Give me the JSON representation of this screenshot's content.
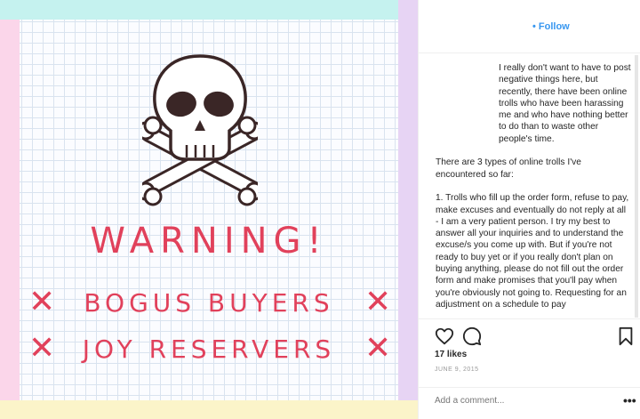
{
  "image": {
    "title": "WARNING!",
    "lines": [
      {
        "mark": "✕",
        "text": "BOGUS BUYERS"
      },
      {
        "mark": "✕",
        "text": "JOY RESERVERS"
      }
    ],
    "colors": {
      "accent": "#e1415b",
      "top_band": "#c5f2ef",
      "left_band": "#fbd6ea",
      "right_band": "#e7d4f4",
      "bottom_band": "#fbf4c9"
    }
  },
  "post": {
    "follow_label": "• Follow",
    "caption": {
      "p1": "I really don't want to have to post negative things here, but recently, there have been online trolls who have been harassing me and who have nothing better to do than to waste other people's time.",
      "p2": "There are 3 types of online trolls I've encountered so far:",
      "p3": "1. Trolls who fill up the order form, refuse to pay, make excuses and eventually do not reply at all - I am a very patient person. I try my best to answer all your inquiries and to understand the excuse/s you come up with. But if you're not ready to buy yet or if you really don't plan on buying anything, please do not fill out the order form and make promises that you'll pay when you're obviously not going to. Requesting for an adjustment on a schedule to pay"
    },
    "likes": "17 likes",
    "date": "JUNE 9, 2015",
    "comment_placeholder": "Add a comment...",
    "more_label": "•••",
    "icons": [
      "heart-icon",
      "comment-icon",
      "bookmark-icon",
      "more-icon"
    ],
    "colors": {
      "link": "#3897f0",
      "text": "#262626",
      "muted": "#999999"
    }
  }
}
